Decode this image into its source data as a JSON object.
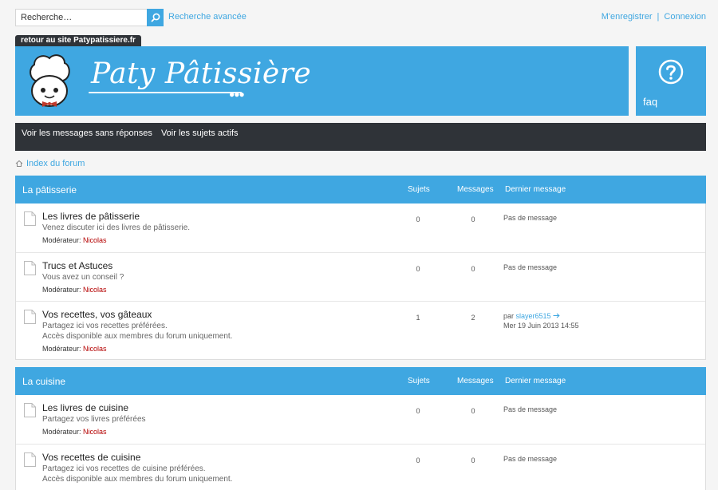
{
  "search": {
    "placeholder": "Recherche…",
    "advanced": "Recherche avancée"
  },
  "user_links": {
    "register": "M'enregistrer",
    "separator": "|",
    "login": "Connexion"
  },
  "site": {
    "back_link": "retour au site Patypatissiere.fr",
    "title": "Paty Pâtissière",
    "faq": "faq"
  },
  "nav": {
    "unanswered": "Voir les messages sans réponses",
    "active": "Voir les sujets actifs"
  },
  "breadcrumb": {
    "home": "Index du forum"
  },
  "colors": {
    "accent": "#3fa7e1",
    "dark": "#2f3338",
    "moderator": "#b40000"
  },
  "categories": [
    {
      "title": "La pâtisserie",
      "col_topics": "Sujets",
      "col_posts": "Messages",
      "col_last": "Dernier message",
      "forums": [
        {
          "title": "Les livres de pâtisserie",
          "desc1": "Venez discuter ici des livres de pâtisserie.",
          "desc2": "",
          "mod_label": "Modérateur:",
          "mod": "Nicolas",
          "topics": "0",
          "posts": "0",
          "last1": "Pas de message",
          "last_prefix": "",
          "last_author": "",
          "last2": ""
        },
        {
          "title": "Trucs et Astuces",
          "desc1": "Vous avez un conseil ?",
          "desc2": "",
          "mod_label": "Modérateur:",
          "mod": "Nicolas",
          "topics": "0",
          "posts": "0",
          "last1": "Pas de message",
          "last_prefix": "",
          "last_author": "",
          "last2": ""
        },
        {
          "title": "Vos recettes, vos gâteaux",
          "desc1": "Partagez ici vos recettes préférées.",
          "desc2": "Accès disponible aux membres du forum uniquement.",
          "mod_label": "Modérateur:",
          "mod": "Nicolas",
          "topics": "1",
          "posts": "2",
          "last1": "",
          "last_prefix": "par",
          "last_author": "slayer6515",
          "last2": "Mer 19 Juin 2013 14:55"
        }
      ]
    },
    {
      "title": "La cuisine",
      "col_topics": "Sujets",
      "col_posts": "Messages",
      "col_last": "Dernier message",
      "forums": [
        {
          "title": "Les livres de cuisine",
          "desc1": "Partagez vos livres préférées",
          "desc2": "",
          "mod_label": "Modérateur:",
          "mod": "Nicolas",
          "topics": "0",
          "posts": "0",
          "last1": "Pas de message",
          "last_prefix": "",
          "last_author": "",
          "last2": ""
        },
        {
          "title": "Vos recettes de cuisine",
          "desc1": "Partagez ici vos recettes de cuisine préférées.",
          "desc2": "Accès disponible aux membres du forum uniquement.",
          "mod_label": "",
          "mod": "",
          "topics": "0",
          "posts": "0",
          "last1": "Pas de message",
          "last_prefix": "",
          "last_author": "",
          "last2": ""
        }
      ]
    }
  ]
}
